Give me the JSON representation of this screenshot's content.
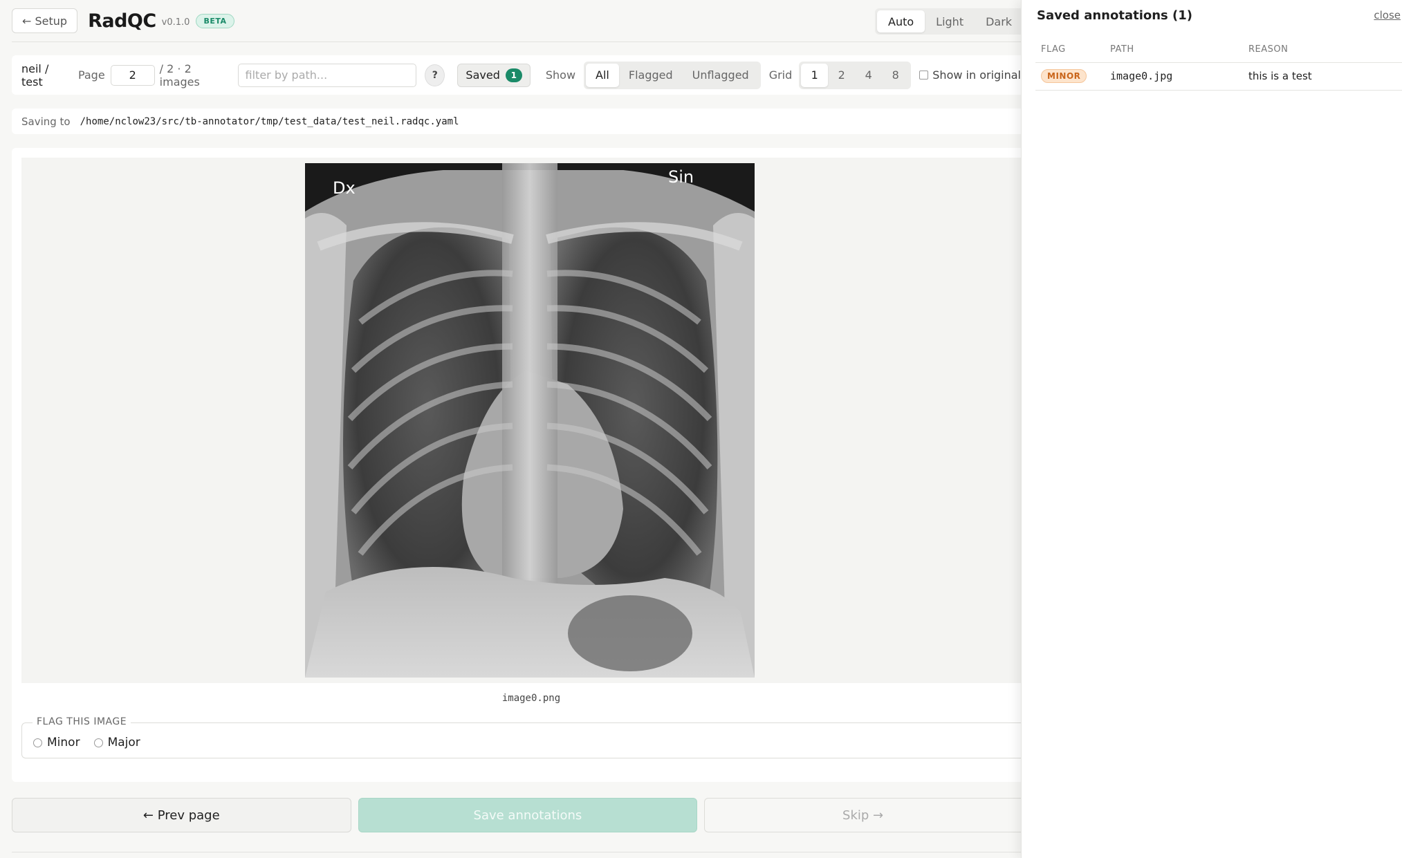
{
  "header": {
    "setup_label": "← Setup",
    "brand": "RadQC",
    "version": "v0.1.0",
    "beta_badge": "BETA",
    "theme_options": [
      {
        "label": "Auto",
        "active": true
      },
      {
        "label": "Light",
        "active": false
      },
      {
        "label": "Dark",
        "active": false
      }
    ]
  },
  "toolbar": {
    "project": "neil / test",
    "page_label": "Page",
    "page_value": "2",
    "page_total": "/ 2 · 2 images",
    "filter_placeholder": "filter by path...",
    "help_label": "?",
    "saved_label": "Saved",
    "saved_count": "1",
    "show_label": "Show",
    "show_options": [
      {
        "label": "All",
        "active": true
      },
      {
        "label": "Flagged",
        "active": false
      },
      {
        "label": "Unflagged",
        "active": false
      }
    ],
    "grid_label": "Grid",
    "grid_options": [
      {
        "label": "1",
        "active": true
      },
      {
        "label": "2",
        "active": false
      },
      {
        "label": "4",
        "active": false
      },
      {
        "label": "8",
        "active": false
      }
    ],
    "show_original_label": "Show in original"
  },
  "saving": {
    "label": "Saving to",
    "path": "/home/nclow23/src/tb-annotator/tmp/test_data/test_neil.radqc.yaml"
  },
  "viewer": {
    "xray_marker_left": "Dx",
    "xray_marker_right": "Sin",
    "caption": "image0.png",
    "flag_legend": "FLAG THIS IMAGE",
    "flag_options": [
      "Minor",
      "Major"
    ]
  },
  "actions": {
    "prev_label": "← Prev page",
    "save_label": "Save annotations",
    "skip_label": "Skip →"
  },
  "side_panel": {
    "title": "Saved annotations (1)",
    "close_label": "close",
    "columns": [
      "FLAG",
      "PATH",
      "REASON"
    ],
    "rows": [
      {
        "flag": "MINOR",
        "path": "image0.jpg",
        "reason": "this is a test"
      }
    ]
  },
  "colors": {
    "accent": "#1a8a68",
    "minor_flag": "#c9651a",
    "save_button_disabled": "#b7dfd2"
  }
}
